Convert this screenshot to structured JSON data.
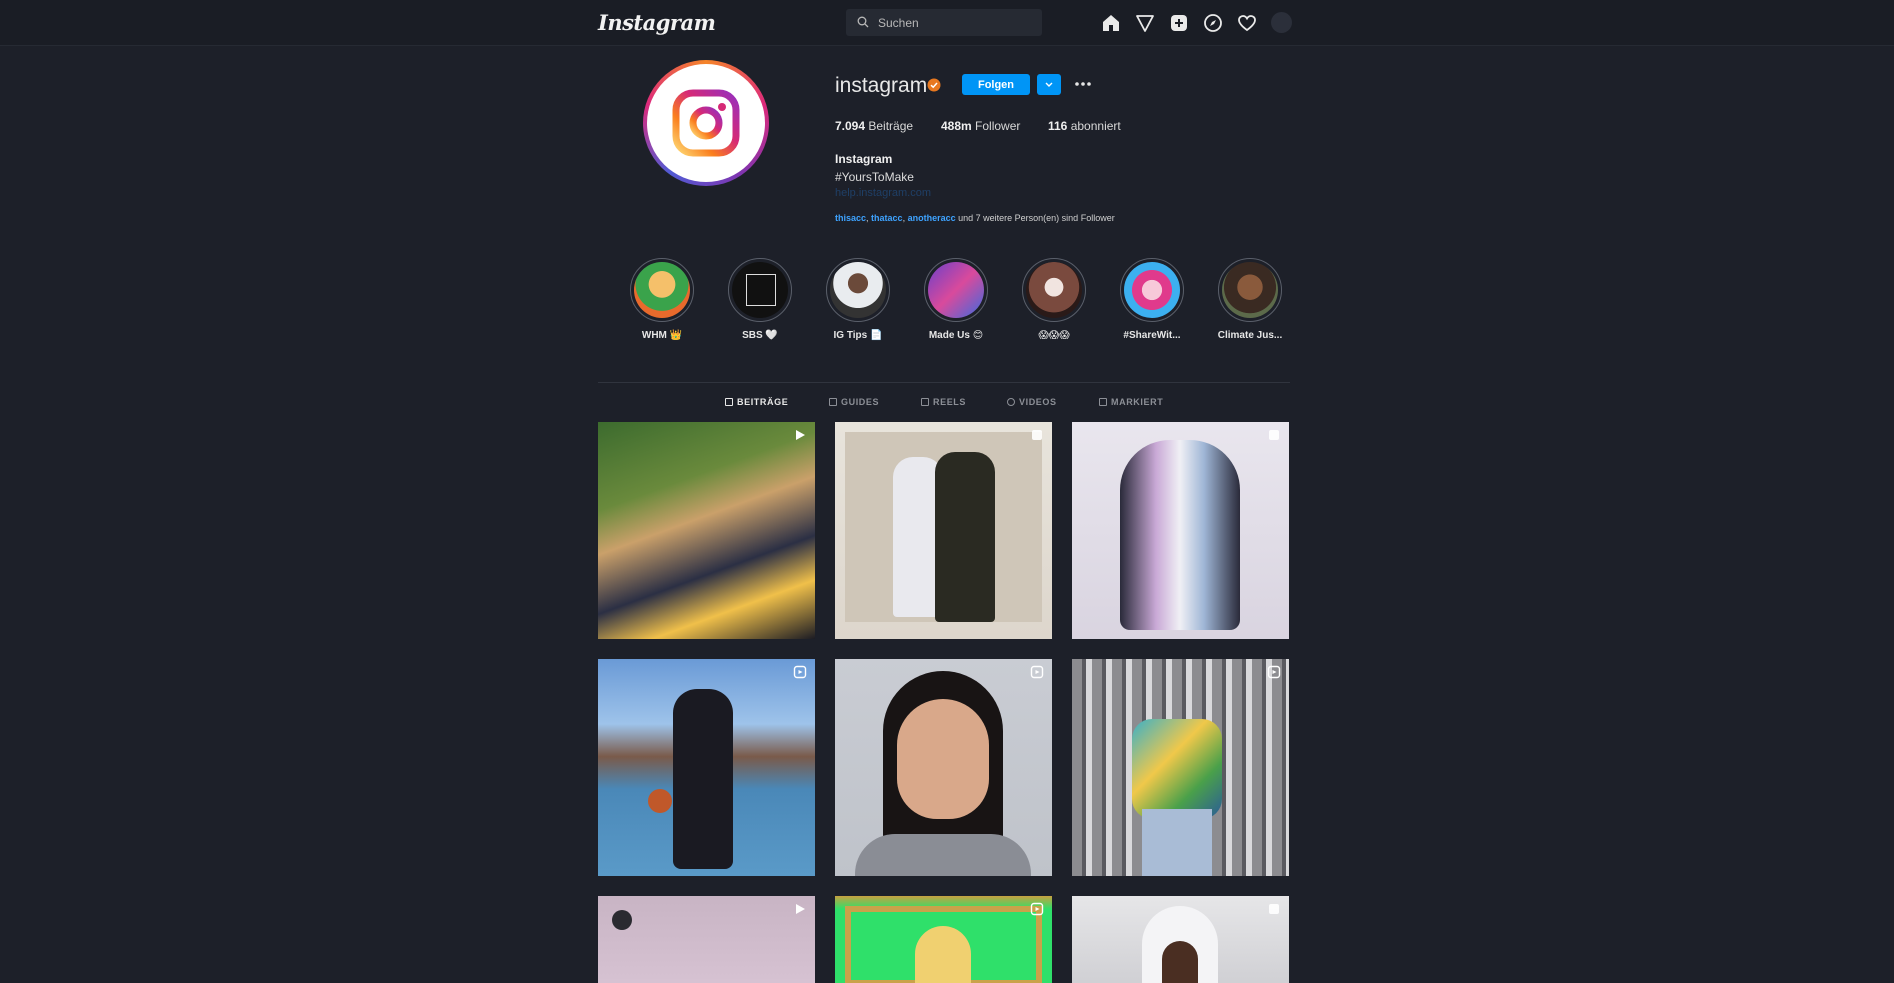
{
  "nav": {
    "logo": "Instagram",
    "search_placeholder": "Suchen",
    "icons": [
      "home-icon",
      "direct-icon",
      "new-post-icon",
      "explore-icon",
      "activity-icon",
      "avatar"
    ]
  },
  "profile": {
    "username": "instagram",
    "follow_label": "Folgen",
    "stats": {
      "posts_num": "7.094",
      "posts_label": "Beiträge",
      "followers_num": "488m",
      "followers_label": "Follower",
      "following_num": "116",
      "following_label": "abonniert"
    },
    "bio_name": "Instagram",
    "bio_tag": "#YoursToMake",
    "bio_link": "help.instagram.com",
    "followed_by": {
      "acc1": "thisacc",
      "acc2": "thatacc",
      "acc3": "anotheracc",
      "rest": "und 7 weitere Person(en) sind Follower"
    }
  },
  "highlights": [
    {
      "label": "WHM 👑"
    },
    {
      "label": "SBS 🤍"
    },
    {
      "label": "IG Tips 📄"
    },
    {
      "label": "Made Us 😊"
    },
    {
      "label": "😱😱😱"
    },
    {
      "label": "#ShareWit..."
    },
    {
      "label": "Climate Jus..."
    }
  ],
  "tabs": [
    {
      "label": "BEITRÄGE"
    },
    {
      "label": "GUIDES"
    },
    {
      "label": "REELS"
    },
    {
      "label": "VIDEOS"
    },
    {
      "label": "MARKIERT"
    }
  ],
  "colors": {
    "accent": "#0095f6",
    "background": "#1d2029",
    "link": "#3ea3ff"
  }
}
